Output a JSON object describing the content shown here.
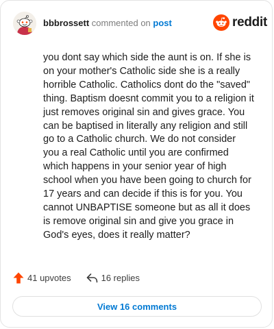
{
  "header": {
    "username": "bbbrossett",
    "action": " commented on ",
    "post_link": "post",
    "logo_text": "reddit"
  },
  "comment": {
    "body": "you dont say which side the aunt is on. If she is on your mother's Catholic side she is a really horrible Catholic. Catholics dont do the \"saved\" thing. Baptism doesnt commit you to a religion it just removes original sin and gives grace. You can be baptised in literally any religion and still go to a Catholic church. We do not consider you a real Catholic until you are confirmed which happens in your senior year of high school when you have been going to church for 17 years and can decide if this is for you. You cannot UNBAPTISE someone but as all it does is remove original sin and give you grace in God's eyes, does it really matter?"
  },
  "footer": {
    "upvotes": "41 upvotes",
    "replies": "16 replies",
    "view_comments": "View 16 comments"
  },
  "colors": {
    "brand": "#ff4500",
    "link": "#0079d3",
    "upvote": "#ff4500"
  },
  "icons": {
    "avatar": "snoo-avatar",
    "logo": "reddit-snoo-icon",
    "upvote": "upvote-arrow-icon",
    "reply": "reply-arrow-icon"
  }
}
